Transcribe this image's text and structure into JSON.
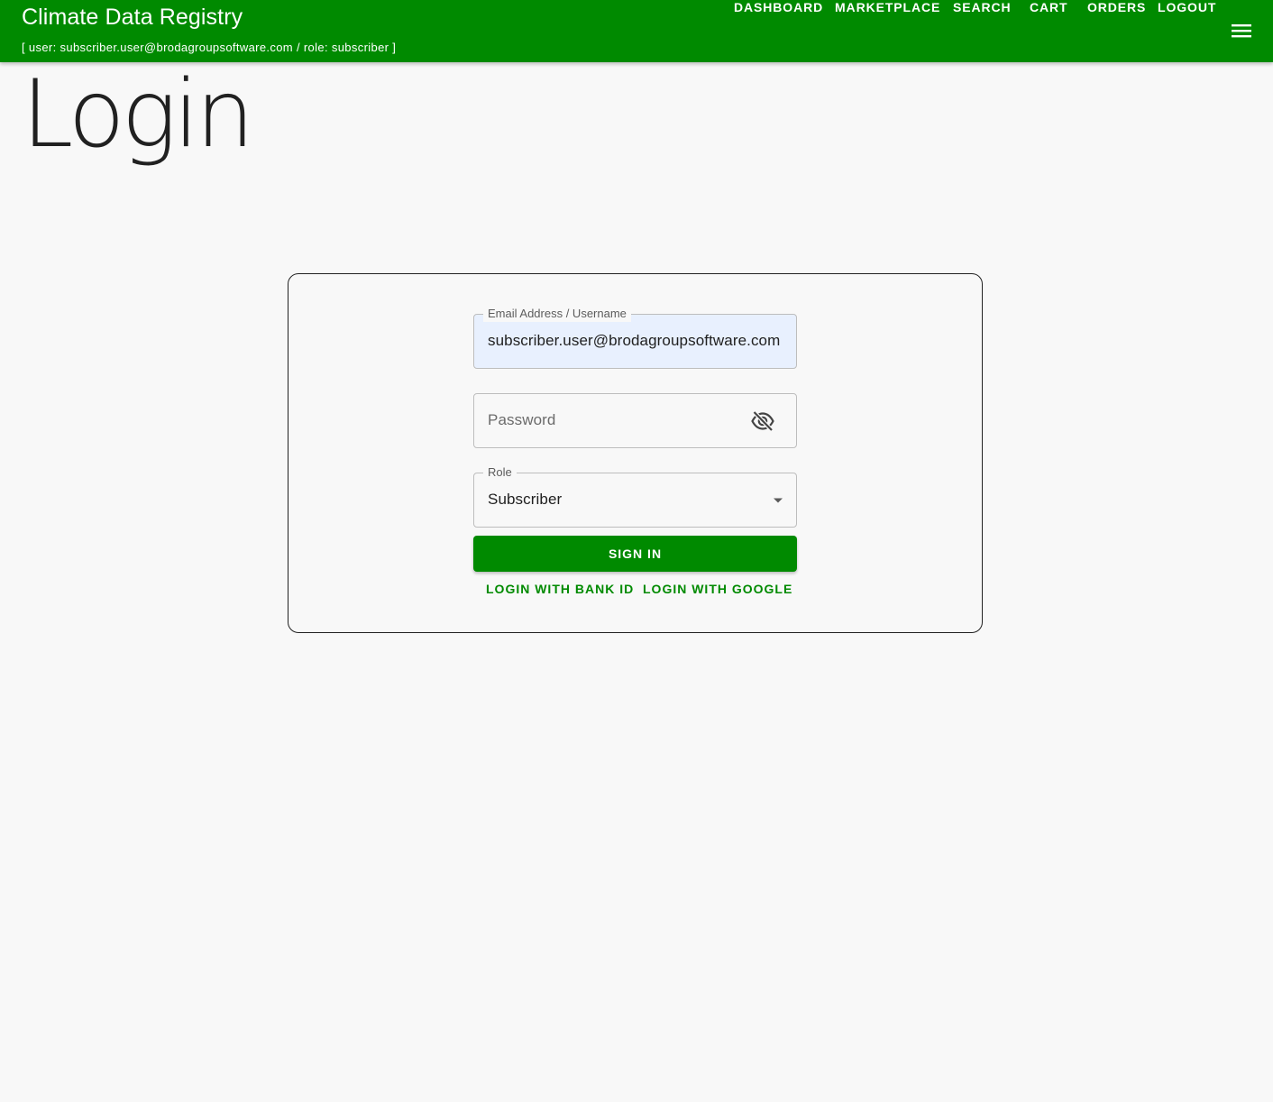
{
  "app": {
    "title": "Climate Data Registry",
    "subtitle": "[ user: subscriber.user@brodagroupsoftware.com / role: subscriber ]",
    "accent_color": "#008a00"
  },
  "nav": {
    "items": [
      {
        "label": "DASHBOARD"
      },
      {
        "label": "MARKETPLACE"
      },
      {
        "label": "SEARCH"
      },
      {
        "label": "CART"
      },
      {
        "label": "ORDERS"
      },
      {
        "label": "LOGOUT"
      }
    ],
    "menu_icon": "hamburger-menu-icon"
  },
  "page": {
    "title": "Login"
  },
  "form": {
    "email": {
      "label": "Email Address / Username",
      "value": "subscriber.user@brodagroupsoftware.com"
    },
    "password": {
      "placeholder": "Password",
      "value": "",
      "visibility_icon": "visibility-off-icon"
    },
    "role": {
      "label": "Role",
      "selected": "Subscriber",
      "dropdown_icon": "arrow-drop-down-icon"
    },
    "sign_in_label": "SIGN IN",
    "bank_id_label": "LOGIN WITH BANK ID",
    "google_label": "LOGIN WITH GOOGLE"
  }
}
